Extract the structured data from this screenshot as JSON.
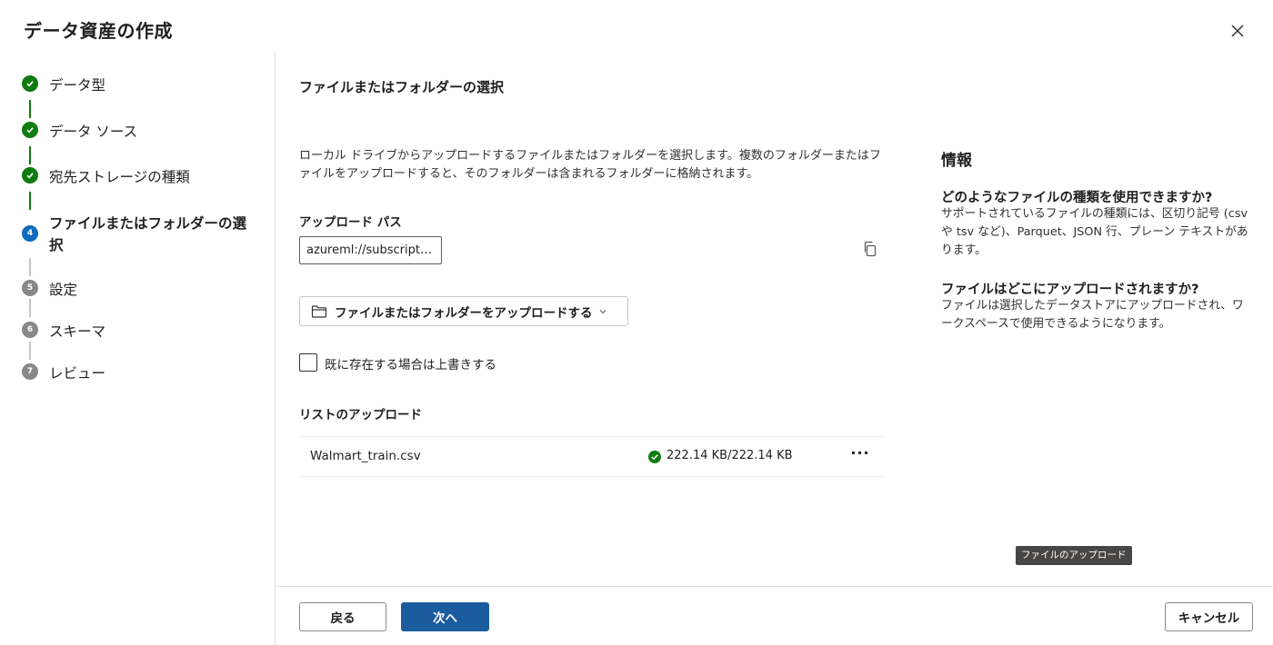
{
  "dialog": {
    "title": "データ資産の作成",
    "close_icon": "close-icon"
  },
  "steps": [
    {
      "label": "データ型",
      "state": "done",
      "number": "1"
    },
    {
      "label": "データ ソース",
      "state": "done",
      "number": "2"
    },
    {
      "label": "宛先ストレージの種類",
      "state": "done",
      "number": "3"
    },
    {
      "label": "ファイルまたはフォルダーの選択",
      "state": "current",
      "number": "4"
    },
    {
      "label": "設定",
      "state": "todo",
      "number": "5"
    },
    {
      "label": "スキーマ",
      "state": "todo",
      "number": "6"
    },
    {
      "label": "レビュー",
      "state": "todo",
      "number": "7"
    }
  ],
  "main": {
    "title": "ファイルまたはフォルダーの選択",
    "description": "ローカル ドライブからアップロードするファイルまたはフォルダーを選択します。複数のフォルダーまたはファイルをアップロードすると、そのフォルダーは含まれるフォルダーに格納されます。",
    "upload_path_label": "アップロード パス",
    "upload_path_value": "azureml://subscriptions/",
    "upload_button_label": "ファイルまたはフォルダーをアップロードする",
    "overwrite_label": "既に存在する場合は上書きする",
    "overwrite_checked": false,
    "list_title": "リストのアップロード",
    "files": [
      {
        "name": "Walmart_train.csv",
        "status": "222.14 KB/222.14 KB",
        "status_icon": "check-circle-icon"
      }
    ],
    "more_label": "···"
  },
  "info": {
    "title": "情報",
    "items": [
      {
        "question": "どのようなファイルの種類を使用できますか?",
        "answer": "サポートされているファイルの種類には、区切り記号 (csv や tsv など)、Parquet、JSON 行、プレーン テキストがあります。"
      },
      {
        "question": "ファイルはどこにアップロードされますか?",
        "answer": "ファイルは選択したデータストアにアップロードされ、ワークスペースで使用できるようになります。"
      }
    ]
  },
  "tooltip": "ファイルのアップロード",
  "footer": {
    "back": "戻る",
    "next": "次へ",
    "cancel": "キャンセル"
  },
  "colors": {
    "done": "#107c10",
    "current": "#0f6cbd",
    "todo": "#8a8886",
    "primary_button": "#1b5c9e"
  }
}
